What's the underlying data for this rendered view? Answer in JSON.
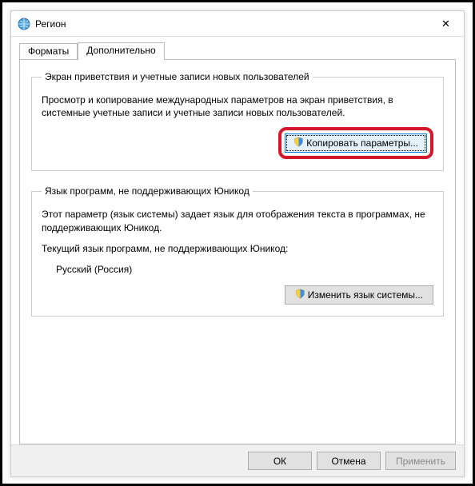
{
  "window": {
    "title": "Регион"
  },
  "tabs": {
    "formats": "Форматы",
    "advanced": "Дополнительно"
  },
  "group1": {
    "legend": "Экран приветствия и учетные записи новых пользователей",
    "desc": "Просмотр и копирование международных параметров на экран приветствия, в системные учетные записи и учетные записи новых пользователей.",
    "button": "Копировать параметры..."
  },
  "group2": {
    "legend": "Язык программ, не поддерживающих Юникод",
    "desc": "Этот параметр (язык системы) задает язык для отображения текста в программах, не поддерживающих Юникод.",
    "currentLabel": "Текущий язык программ, не поддерживающих Юникод:",
    "currentValue": "Русский (Россия)",
    "button": "Изменить язык системы..."
  },
  "footer": {
    "ok": "ОК",
    "cancel": "Отмена",
    "apply": "Применить"
  }
}
